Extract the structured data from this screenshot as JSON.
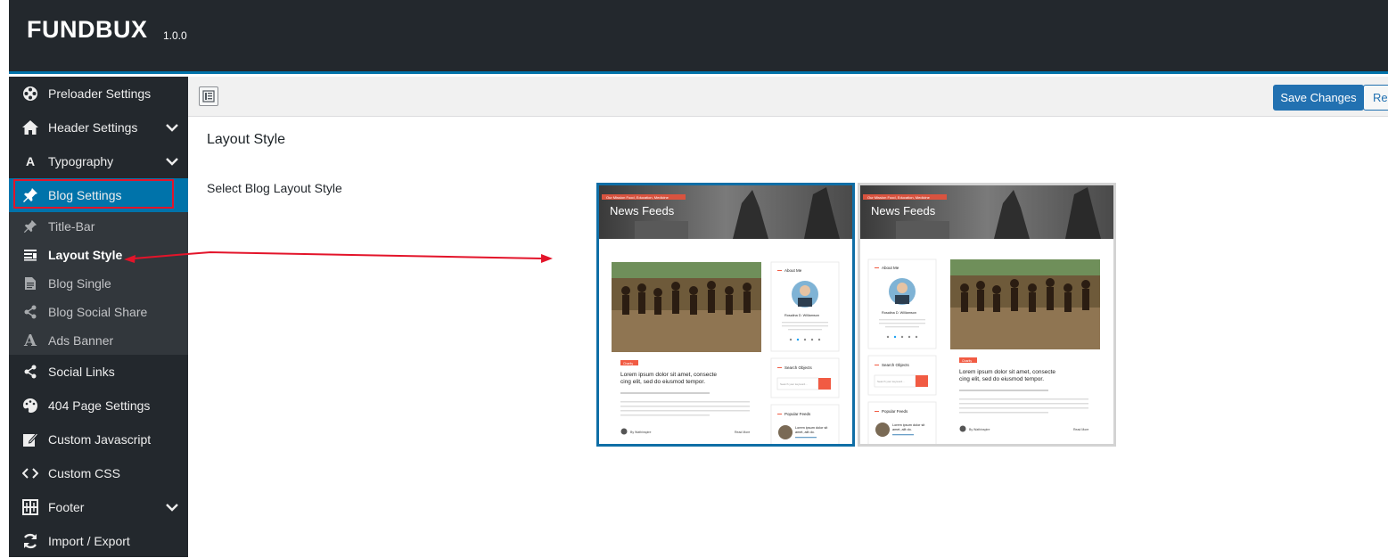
{
  "header": {
    "brand": "FUNDBUX",
    "version": "1.0.0"
  },
  "sidebar": {
    "items": [
      {
        "label": "Preloader Settings",
        "icon": "preloader-icon"
      },
      {
        "label": "Header Settings",
        "icon": "home-icon",
        "expandable": true
      },
      {
        "label": "Typography",
        "icon": "typography-icon",
        "expandable": true
      },
      {
        "label": "Blog Settings",
        "icon": "pin-icon",
        "active": true
      },
      {
        "label": "Social Links",
        "icon": "share-icon"
      },
      {
        "label": "404 Page Settings",
        "icon": "palette-icon"
      },
      {
        "label": "Custom Javascript",
        "icon": "edit-icon"
      },
      {
        "label": "Custom CSS",
        "icon": "code-icon"
      },
      {
        "label": "Footer",
        "icon": "grid-icon",
        "expandable": true
      },
      {
        "label": "Import / Export",
        "icon": "refresh-icon"
      }
    ],
    "blog_submenu": [
      {
        "label": "Title-Bar",
        "icon": "pin-icon"
      },
      {
        "label": "Layout Style",
        "icon": "layout-icon",
        "current": true
      },
      {
        "label": "Blog Single",
        "icon": "document-icon"
      },
      {
        "label": "Blog Social Share",
        "icon": "share-icon"
      },
      {
        "label": "Ads Banner",
        "icon": "font-icon"
      }
    ]
  },
  "toolbar": {
    "save_label": "Save Changes",
    "reset_label": "Res"
  },
  "main": {
    "section_title": "Layout Style",
    "field_label": "Select Blog Layout Style",
    "options": [
      {
        "selected": true,
        "banner_tag": "Our Mission Food, Education, Medicine",
        "banner_title": "News Feeds",
        "post_tag": "Charity",
        "post_title": "Lorem ipsum dolor sit amet, consecte cing elit, sed do eiusmod tempor.",
        "author": "By Wathinspire",
        "read_more": "Read More",
        "about_title": "About Me",
        "about_name": "Rosalina D. Williamson",
        "search_title": "Search Objects",
        "search_placeholder": "Search your keyword...",
        "popular_title": "Popular Feeds",
        "popular_post": "Lorem ipsum dolor sit amet, alit do."
      },
      {
        "selected": false,
        "banner_tag": "Our Mission Food, Education, Medicine",
        "banner_title": "News Feeds",
        "post_tag": "Charity",
        "post_title": "Lorem ipsum dolor sit amet, consecte cing elit, sed do eiusmod tempor.",
        "author": "By Wathinspire",
        "read_more": "Read More",
        "about_title": "About Me",
        "about_name": "Rosalina D. Williamson",
        "search_title": "Search Objects",
        "search_placeholder": "Search your keyword...",
        "popular_title": "Popular Feeds",
        "popular_post": "Lorem ipsum dolor sit amet, alit do."
      }
    ]
  },
  "colors": {
    "accent": "#0073aa",
    "save": "#2271b1",
    "annotation": "#e3142a",
    "tag": "#f15b43"
  }
}
